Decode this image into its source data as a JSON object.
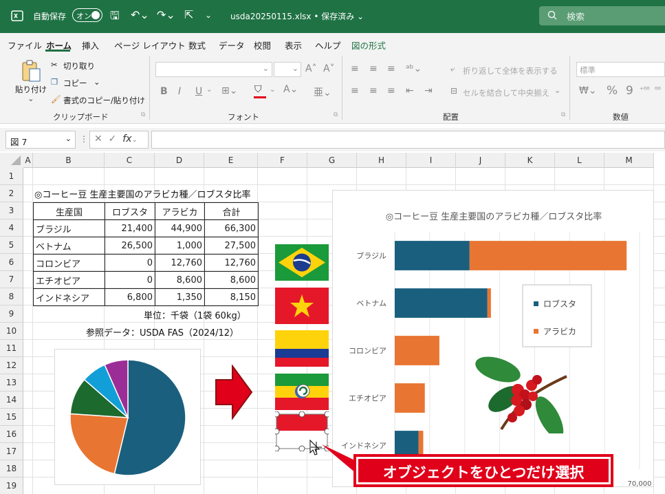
{
  "titlebar": {
    "autosave_label": "自動保存",
    "autosave_state": "オン",
    "filename": "usda20250115.xlsx • 保存済み ⌄",
    "search_placeholder": "検索",
    "brand_color": "#1f7244"
  },
  "menu": [
    "ファイル",
    "ホーム",
    "挿入",
    "ページ レイアウト",
    "数式",
    "データ",
    "校閲",
    "表示",
    "ヘルプ",
    "図の形式"
  ],
  "ribbon": {
    "paste": "貼り付け",
    "cut": "切り取り",
    "copy": "コピー",
    "format_painter": "書式のコピー/貼り付け",
    "clipboard_group": "クリップボード",
    "font_group": "フォント",
    "wrap_text": "折り返して全体を表示する",
    "merge_center": "セルを結合して中央揃え",
    "alignment_group": "配置",
    "number_format": "標準",
    "number_group": "数値"
  },
  "formula": {
    "name_box": "図 7",
    "fx": "fx"
  },
  "columns": [
    "A",
    "B",
    "C",
    "D",
    "E",
    "F",
    "G",
    "H",
    "I",
    "J",
    "K",
    "L",
    "M"
  ],
  "rows": [
    "1",
    "2",
    "3",
    "4",
    "5",
    "6",
    "7",
    "8",
    "9",
    "10",
    "11",
    "12",
    "13",
    "14",
    "15",
    "16",
    "17",
    "18",
    "19"
  ],
  "sheet": {
    "title": "◎コーヒー豆 生産主要国のアラビカ種／ロブスタ比率",
    "headers": [
      "生産国",
      "ロブスタ",
      "アラビカ",
      "合計"
    ],
    "table": [
      [
        "ブラジル",
        "21,400",
        "44,900",
        "66,300"
      ],
      [
        "ベトナム",
        "26,500",
        "1,000",
        "27,500"
      ],
      [
        "コロンビア",
        "0",
        "12,760",
        "12,760"
      ],
      [
        "エチオピア",
        "0",
        "8,600",
        "8,600"
      ],
      [
        "インドネシア",
        "6,800",
        "1,350",
        "8,150"
      ]
    ],
    "unit_note": "単位：千袋（1袋 60kg）",
    "source_note": "参照データ：USDA FAS（2024/12）"
  },
  "chart_data": [
    {
      "type": "bar",
      "stacked": true,
      "orientation": "horizontal",
      "title": "◎コーヒー豆 生産主要国のアラビカ種／ロブスタ比率",
      "categories": [
        "ブラジル",
        "ベトナム",
        "コロンビア",
        "エチオピア",
        "インドネシア"
      ],
      "series": [
        {
          "name": "ロブスタ",
          "values": [
            21400,
            26500,
            0,
            0,
            6800
          ],
          "color": "#1a5f7e"
        },
        {
          "name": "アラビカ",
          "values": [
            44900,
            1000,
            12760,
            8600,
            1350
          ],
          "color": "#e97532"
        }
      ],
      "xlim": [
        0,
        70000
      ],
      "x_tick_label": "70,000",
      "legend": "right",
      "grid": true
    },
    {
      "type": "pie",
      "values": [
        66300,
        27500,
        12760,
        8600,
        8150
      ],
      "colors": [
        "#1a5f7e",
        "#e97532",
        "#1d6a2e",
        "#129fd8",
        "#9b2d96"
      ]
    }
  ],
  "callout_text": "オブジェクトをひとつだけ選択"
}
